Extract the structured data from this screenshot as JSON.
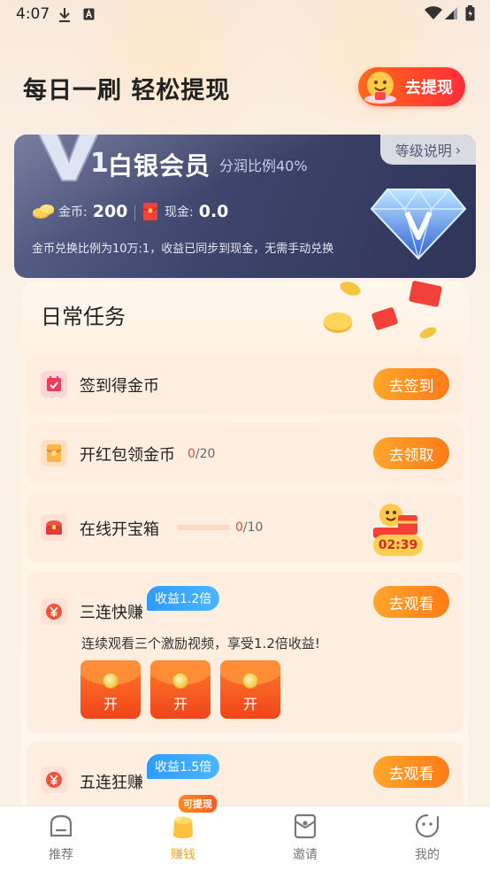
{
  "status_bar": {
    "time": "4:07"
  },
  "header": {
    "title": "每日一刷 轻松提现",
    "withdraw_label": "去提现"
  },
  "member": {
    "level_mark": "V1",
    "level_name": "白银会员",
    "ratio": "分润比例40%",
    "level_help": "等级说明",
    "coin_label": "金币:",
    "coin_value": "200",
    "cash_label": "现金:",
    "cash_value": "0.0",
    "note": "金币兑换比例为10万:1，收益已同步到现金，无需手动兑换"
  },
  "tasks": {
    "title": "日常任务",
    "items": [
      {
        "name": "签到得金币",
        "button": "去签到"
      },
      {
        "name": "开红包领金币",
        "progress_current": "0",
        "progress_total": "/20",
        "button": "去领取"
      },
      {
        "name": "在线开宝箱",
        "progress_current": "0",
        "progress_total": "/10",
        "progress_fraction": 0,
        "timer": "02:39"
      },
      {
        "name": "三连快赚",
        "badge": "收益1.2倍",
        "button": "去观看",
        "desc": "连续观看三个激励视频，享受1.2倍收益!",
        "envelopes": [
          "开",
          "开",
          "开"
        ]
      },
      {
        "name": "五连狂赚",
        "badge": "收益1.5倍",
        "button": "去观看"
      }
    ]
  },
  "bottom_nav": {
    "items": [
      {
        "label": "推荐"
      },
      {
        "label": "赚钱",
        "badge": "可提现"
      },
      {
        "label": "邀请"
      },
      {
        "label": "我的"
      }
    ],
    "active_color": "#f5a623"
  }
}
